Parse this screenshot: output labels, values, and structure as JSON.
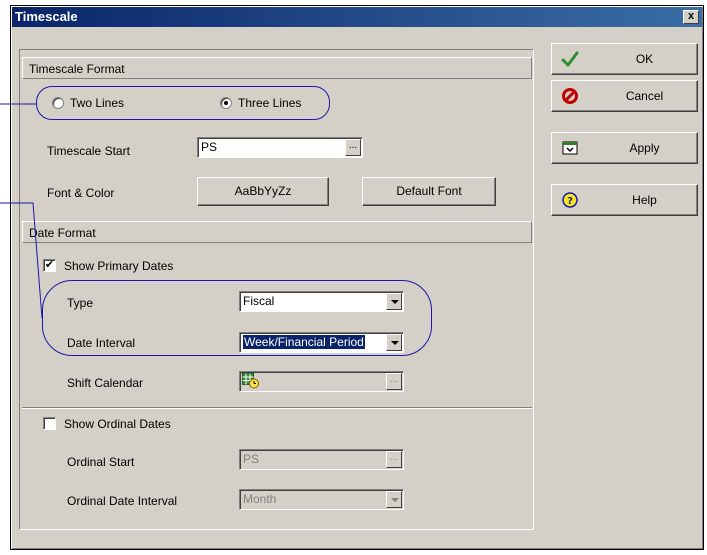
{
  "window": {
    "title": "Timescale",
    "close_glyph": "x"
  },
  "timescale_format": {
    "header": "Timescale Format",
    "option_two_lines": "Two Lines",
    "option_three_lines": "Three Lines",
    "selected": "Three Lines",
    "start_label": "Timescale Start",
    "start_value": "PS",
    "ellipsis": "...",
    "font_color_label": "Font & Color",
    "font_sample_button": "AaBbYyZz",
    "default_font_button": "Default Font"
  },
  "date_format": {
    "header": "Date Format",
    "show_primary_label": "Show Primary Dates",
    "show_primary_checked": true,
    "type_label": "Type",
    "type_value": "Fiscal",
    "interval_label": "Date Interval",
    "interval_value": "Week/Financial Period",
    "shift_calendar_label": "Shift Calendar",
    "show_ordinal_label": "Show Ordinal Dates",
    "show_ordinal_checked": false,
    "ordinal_start_label": "Ordinal Start",
    "ordinal_start_value": "PS",
    "ordinal_interval_label": "Ordinal Date Interval",
    "ordinal_interval_value": "Month"
  },
  "side_buttons": {
    "ok": "OK",
    "cancel": "Cancel",
    "apply": "Apply",
    "help": "Help"
  },
  "icons": [
    "check-icon",
    "cancel-icon",
    "apply-icon",
    "help-icon",
    "calendar-icon"
  ],
  "colors": {
    "title_bar": "#0a246a",
    "dialog_bg": "#d4d0c8",
    "annotation": "#1a1aa8",
    "selection": "#0a246a"
  }
}
